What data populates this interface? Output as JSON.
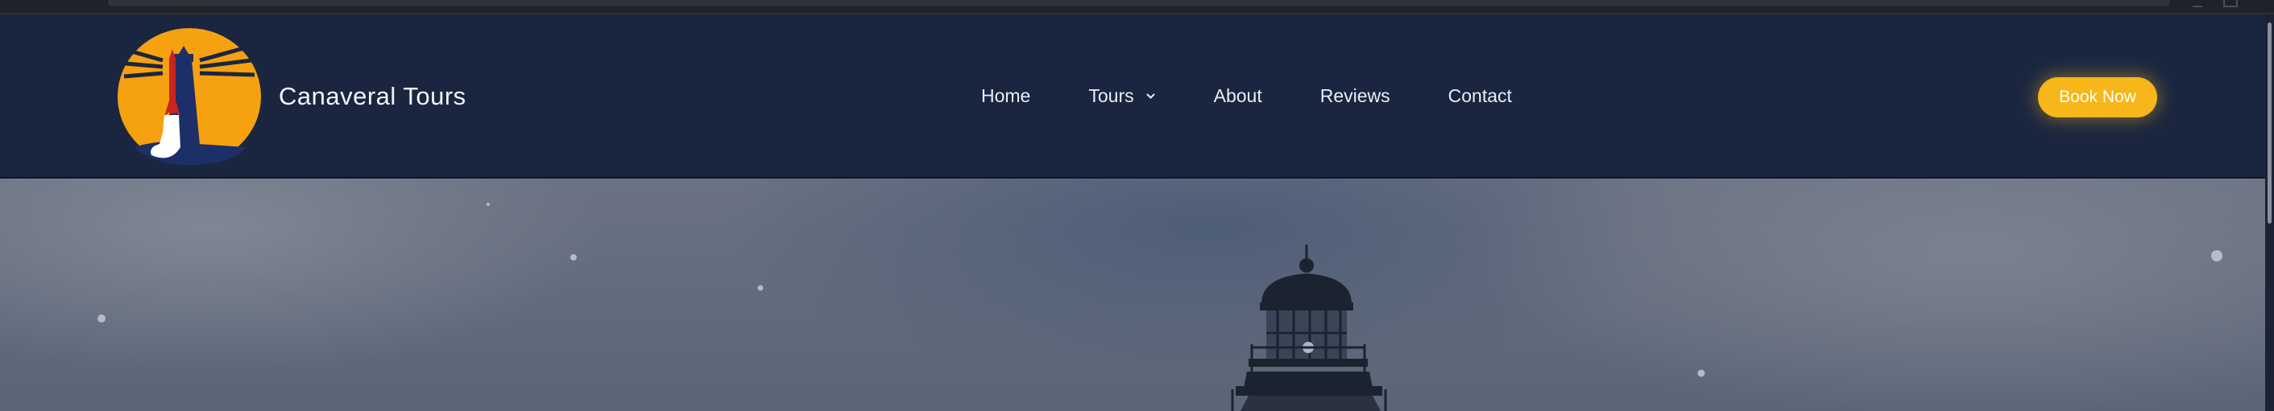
{
  "brand": {
    "name": "Canaveral Tours",
    "logo_icon": "lighthouse-rocket-sunset-logo",
    "colors": {
      "sun": "#f6a10f",
      "tower": "#1c2f66",
      "rocket": "#c8251f"
    }
  },
  "nav": {
    "items": [
      {
        "label": "Home"
      },
      {
        "label": "Tours",
        "icon": "chevron-down-icon"
      },
      {
        "label": "About"
      },
      {
        "label": "Reviews"
      },
      {
        "label": "Contact"
      }
    ]
  },
  "cta": {
    "label": "Book Now",
    "color": "#f7b619"
  },
  "theme": {
    "navbar_bg": "#1a2640",
    "nav_text": "#e9edf5"
  },
  "hero": {
    "image": "lighthouse-under-stormy-sky-photo"
  }
}
